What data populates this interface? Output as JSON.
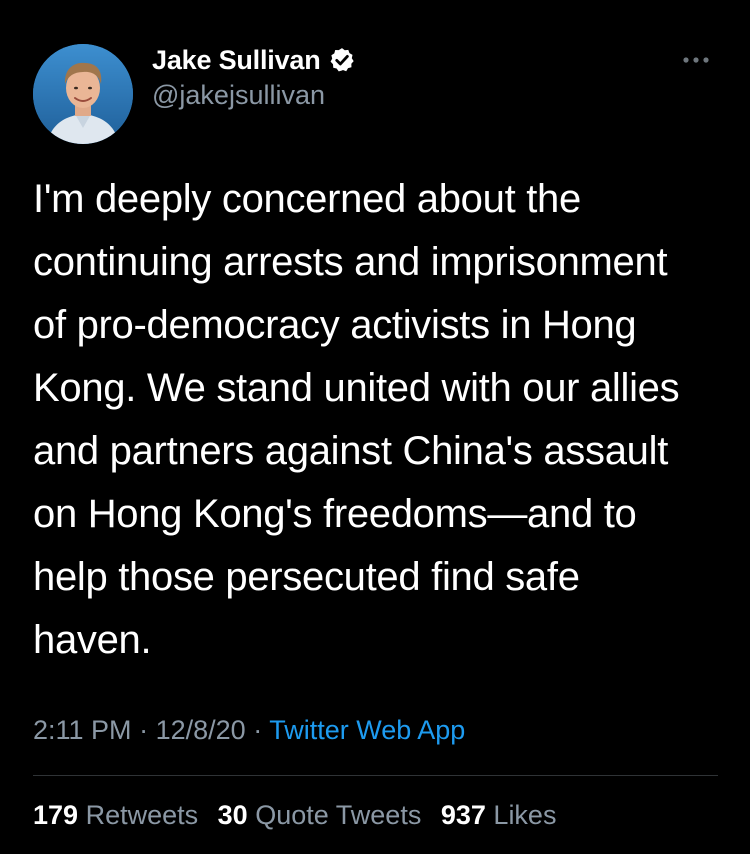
{
  "author": {
    "display_name": "Jake Sullivan",
    "handle": "@jakejsullivan",
    "verified": true,
    "avatar_icon": "profile-photo"
  },
  "tweet": {
    "text": "I'm deeply concerned about the\ncontinuing arrests and imprisonment\nof pro-democracy activists in Hong\nKong. We stand united with our allies\nand partners against China's assault\non Hong Kong's freedoms—and to\nhelp those persecuted find safe\nhaven."
  },
  "meta": {
    "time": "2:11 PM",
    "separator": "·",
    "date": "12/8/20",
    "source": "Twitter Web App"
  },
  "stats": {
    "retweets_count": "179",
    "retweets_label": "Retweets",
    "quotes_count": "30",
    "quotes_label": "Quote Tweets",
    "likes_count": "937",
    "likes_label": "Likes"
  },
  "colors": {
    "background": "#000000",
    "text_primary": "#ffffff",
    "text_secondary": "#8b98a5",
    "link": "#1d9bf0",
    "divider": "#2f3336"
  }
}
